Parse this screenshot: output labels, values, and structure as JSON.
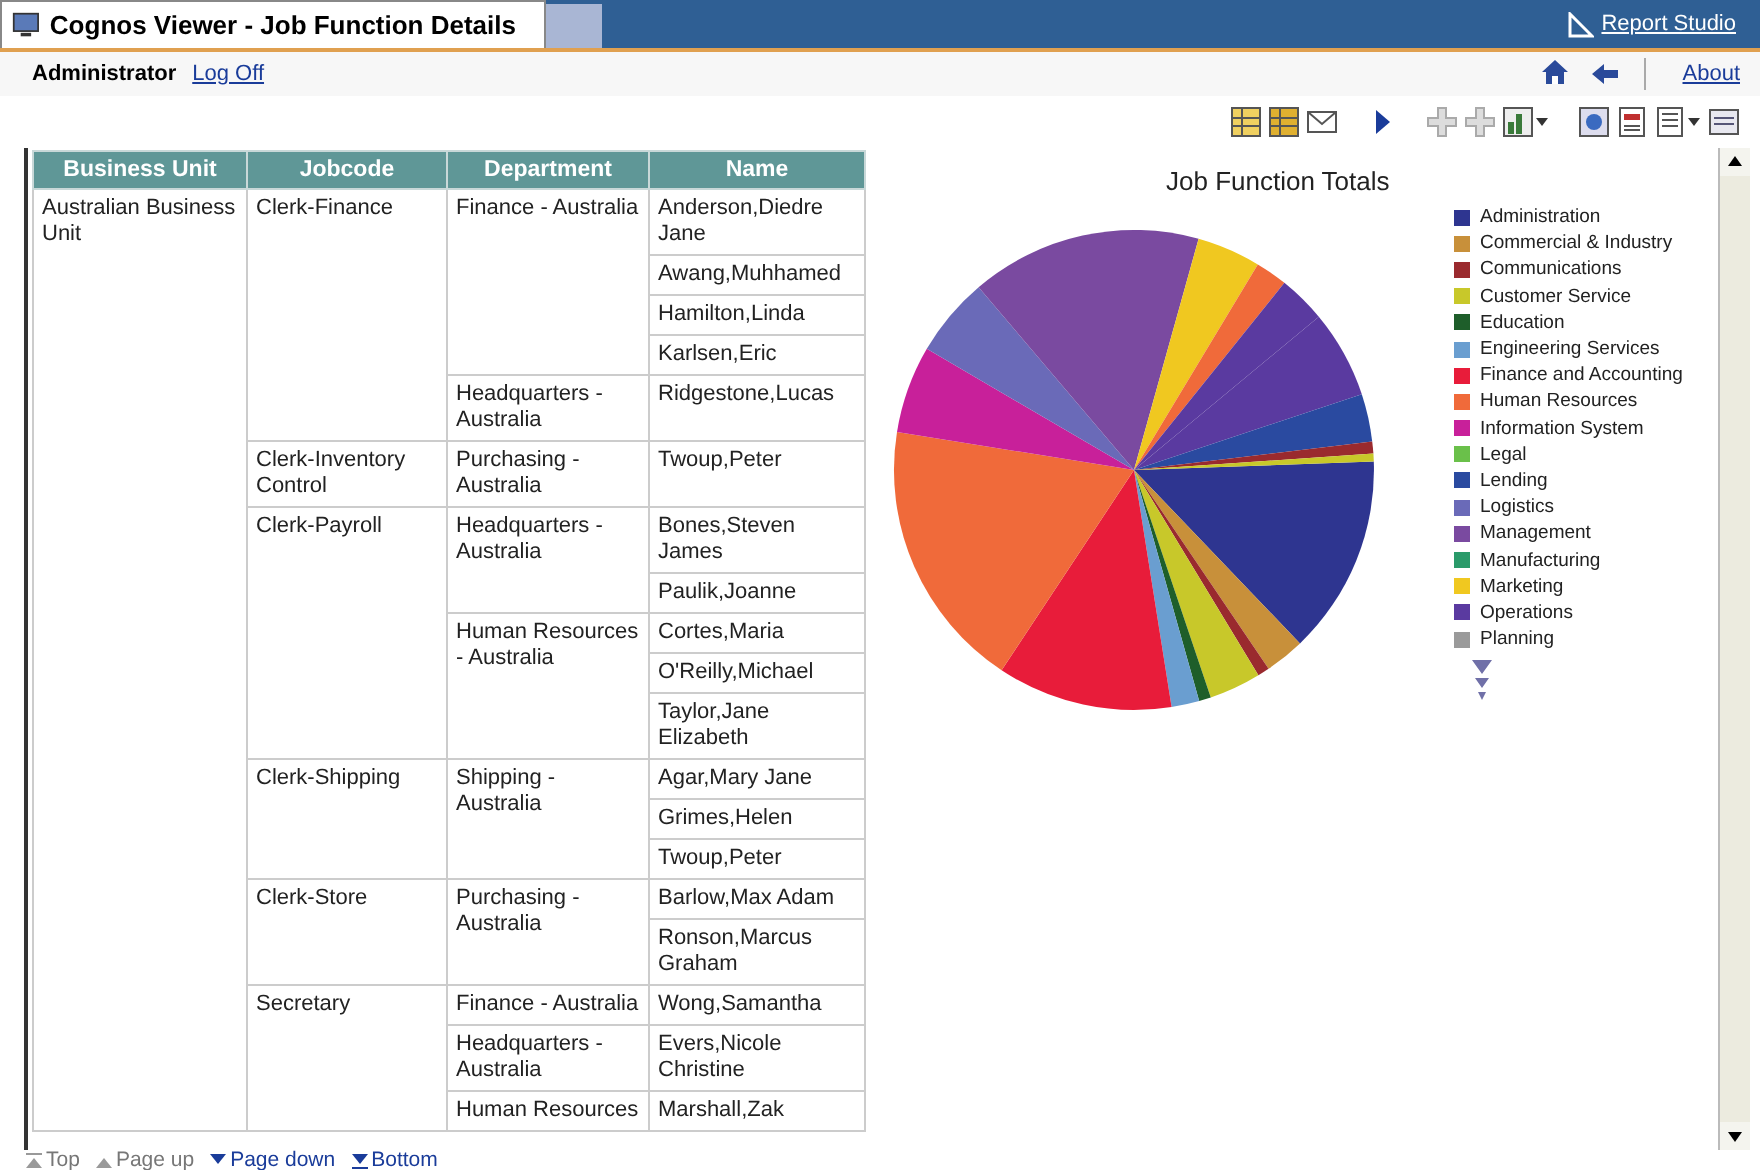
{
  "window": {
    "title": "Cognos Viewer - Job Function Details"
  },
  "header": {
    "studio_link": "Report Studio",
    "user": "Administrator",
    "logoff": "Log Off",
    "about": "About"
  },
  "table": {
    "columns": [
      "Business Unit",
      "Jobcode",
      "Department",
      "Name"
    ],
    "units": [
      {
        "name": "Australian Business Unit",
        "jobcodes": [
          {
            "name": "Clerk-Finance",
            "departments": [
              {
                "name": "Finance - Australia",
                "people": [
                  "Anderson,Diedre Jane",
                  "Awang,Muhhamed",
                  "Hamilton,Linda",
                  "Karlsen,Eric"
                ]
              },
              {
                "name": "Headquarters - Australia",
                "people": [
                  "Ridgestone,Lucas"
                ]
              }
            ]
          },
          {
            "name": "Clerk-Inventory Control",
            "departments": [
              {
                "name": "Purchasing - Australia",
                "people": [
                  "Twoup,Peter"
                ]
              }
            ]
          },
          {
            "name": "Clerk-Payroll",
            "departments": [
              {
                "name": "Headquarters - Australia",
                "people": [
                  "Bones,Steven James",
                  "Paulik,Joanne"
                ]
              },
              {
                "name": "Human Resources - Australia",
                "people": [
                  "Cortes,Maria",
                  "O'Reilly,Michael",
                  "Taylor,Jane Elizabeth"
                ]
              }
            ]
          },
          {
            "name": "Clerk-Shipping",
            "departments": [
              {
                "name": "Shipping - Australia",
                "people": [
                  "Agar,Mary Jane",
                  "Grimes,Helen",
                  "Twoup,Peter"
                ]
              }
            ]
          },
          {
            "name": "Clerk-Store",
            "departments": [
              {
                "name": "Purchasing - Australia",
                "people": [
                  "Barlow,Max Adam",
                  "Ronson,Marcus Graham"
                ]
              }
            ]
          },
          {
            "name": "Secretary",
            "departments": [
              {
                "name": "Finance - Australia",
                "people": [
                  "Wong,Samantha"
                ]
              },
              {
                "name": "Headquarters - Australia",
                "people": [
                  "Evers,Nicole Christine"
                ]
              },
              {
                "name": "Human Resources",
                "people": [
                  "Marshall,Zak"
                ]
              }
            ]
          }
        ]
      }
    ]
  },
  "chart": {
    "title": "Job Function Totals",
    "legend": [
      {
        "label": "Administration",
        "color": "#2e3590"
      },
      {
        "label": "Commercial & Industry",
        "color": "#c8903a"
      },
      {
        "label": "Communications",
        "color": "#9a2a2e"
      },
      {
        "label": "Customer Service",
        "color": "#c8c82a"
      },
      {
        "label": "Education",
        "color": "#1e5e2a"
      },
      {
        "label": "Engineering Services",
        "color": "#6a9ed0"
      },
      {
        "label": "Finance and Accounting",
        "color": "#e81c3a"
      },
      {
        "label": "Human Resources",
        "color": "#f06a3a"
      },
      {
        "label": "Information System",
        "color": "#c8209a"
      },
      {
        "label": "Legal",
        "color": "#6ac04a"
      },
      {
        "label": "Lending",
        "color": "#2a4aa0"
      },
      {
        "label": "Logistics",
        "color": "#6a6ab8"
      },
      {
        "label": "Management",
        "color": "#7a4aa0"
      },
      {
        "label": "Manufacturing",
        "color": "#2a9a6a"
      },
      {
        "label": "Marketing",
        "color": "#f0c820"
      },
      {
        "label": "Operations",
        "color": "#5a3aa0"
      },
      {
        "label": "Planning",
        "color": "#9a9a9a"
      }
    ]
  },
  "page_nav": [
    {
      "label": "Top",
      "disabled": true
    },
    {
      "label": "Page up",
      "disabled": true
    },
    {
      "label": "Page down",
      "disabled": false
    },
    {
      "label": "Bottom",
      "disabled": false
    }
  ]
}
